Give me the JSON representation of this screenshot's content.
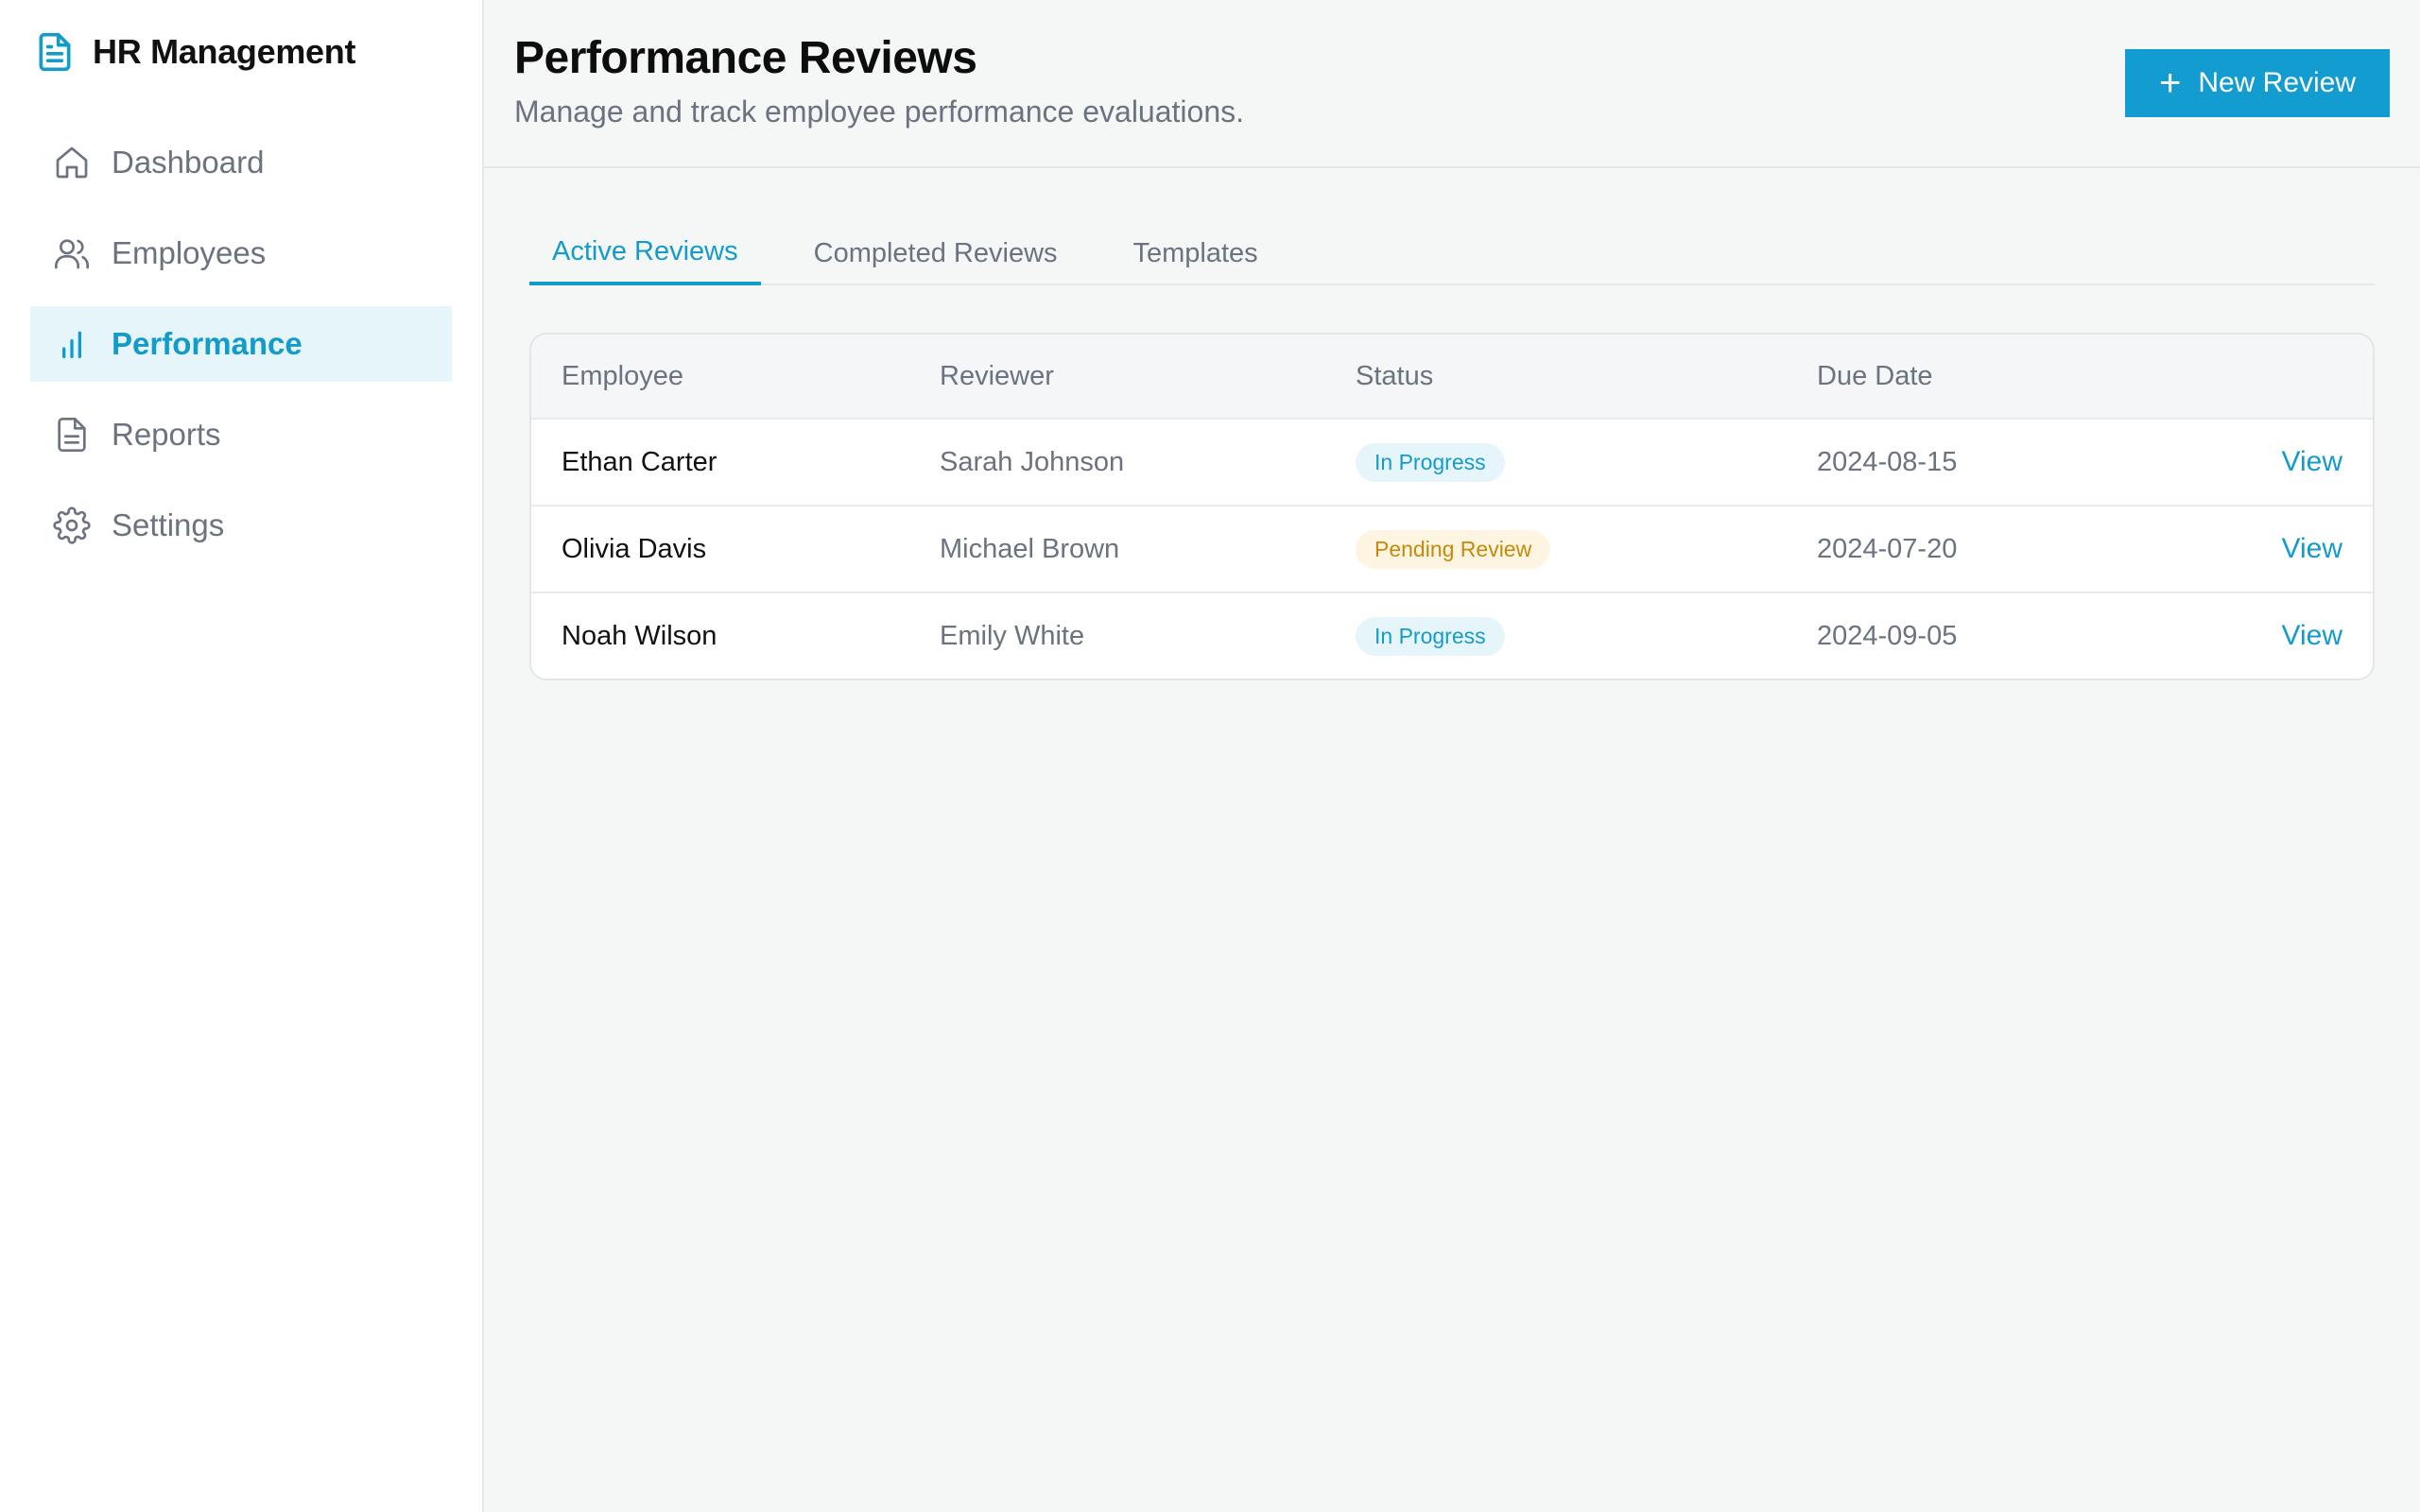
{
  "app": {
    "title": "HR Management",
    "accent": "#139cc9"
  },
  "sidebar": {
    "items": [
      {
        "label": "Dashboard",
        "icon": "home-icon",
        "active": false
      },
      {
        "label": "Employees",
        "icon": "users-icon",
        "active": false
      },
      {
        "label": "Performance",
        "icon": "bar-chart-icon",
        "active": true
      },
      {
        "label": "Reports",
        "icon": "file-text-icon",
        "active": false
      },
      {
        "label": "Settings",
        "icon": "gear-icon",
        "active": false
      }
    ]
  },
  "header": {
    "title": "Performance Reviews",
    "subtitle": "Manage and track employee performance evaluations.",
    "new_button_label": "New Review",
    "new_button_icon": "plus-icon"
  },
  "tabs": [
    {
      "label": "Active Reviews",
      "active": true
    },
    {
      "label": "Completed Reviews",
      "active": false
    },
    {
      "label": "Templates",
      "active": false
    }
  ],
  "table": {
    "columns": [
      "Employee",
      "Reviewer",
      "Status",
      "Due Date"
    ],
    "rows": [
      {
        "employee": "Ethan Carter",
        "reviewer": "Sarah Johnson",
        "status": "In Progress",
        "due": "2024-08-15",
        "action": "View"
      },
      {
        "employee": "Olivia Davis",
        "reviewer": "Michael Brown",
        "status": "Pending Review",
        "due": "2024-07-20",
        "action": "View"
      },
      {
        "employee": "Noah Wilson",
        "reviewer": "Emily White",
        "status": "In Progress",
        "due": "2024-09-05",
        "action": "View"
      }
    ]
  }
}
